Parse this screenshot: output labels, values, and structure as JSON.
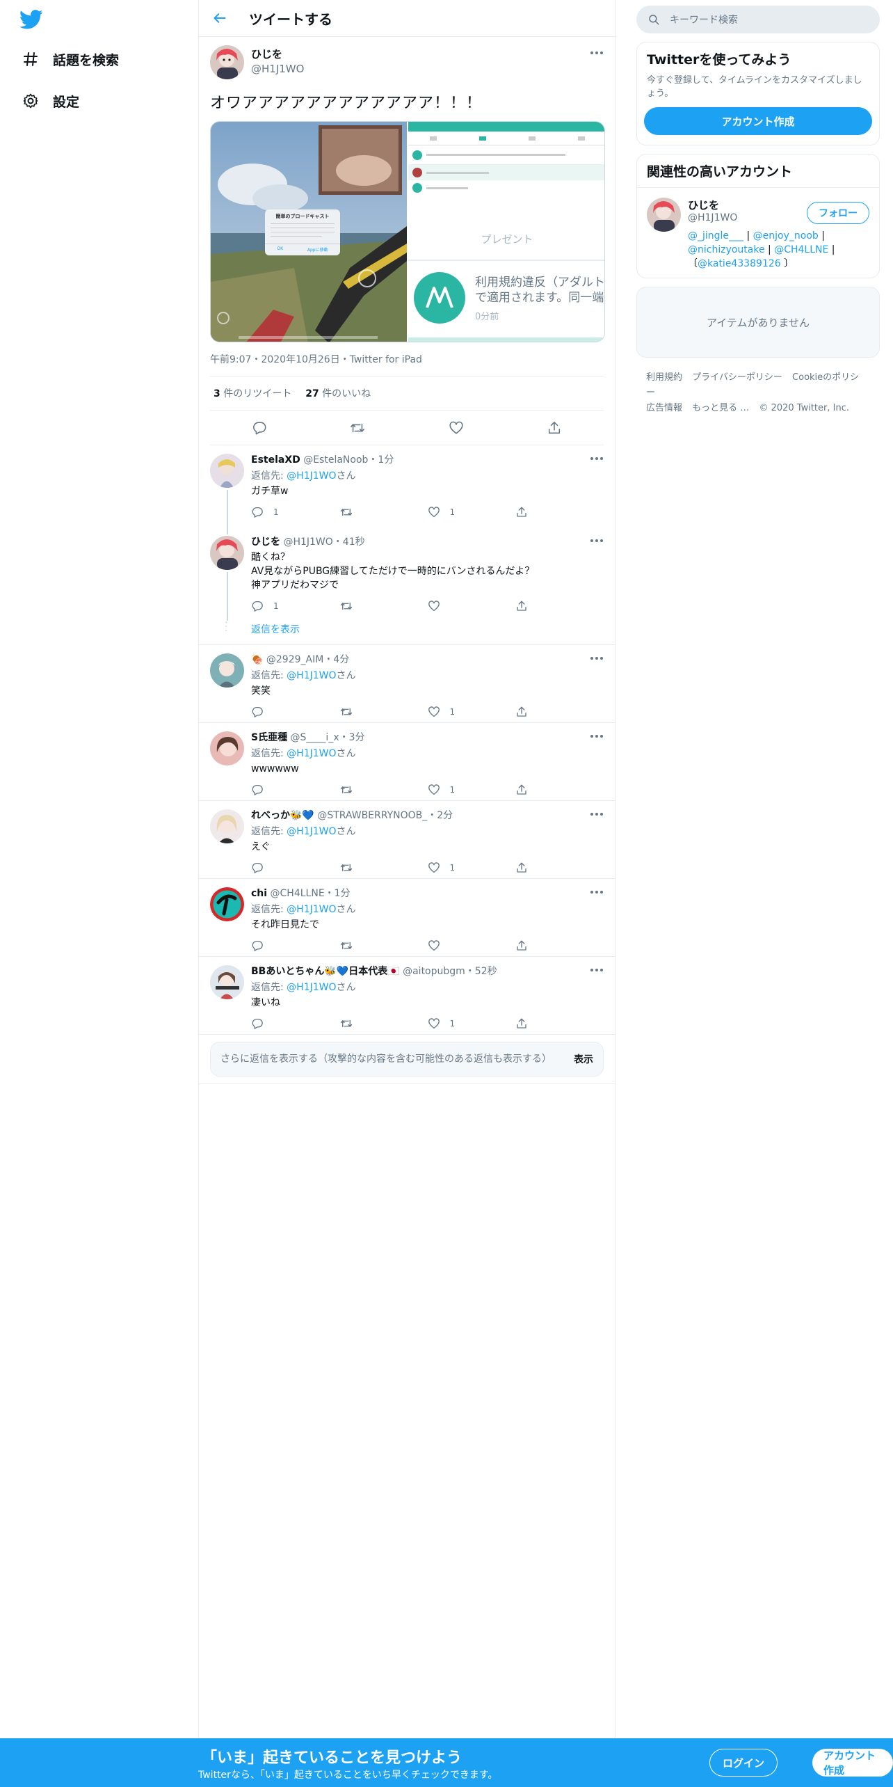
{
  "nav": {
    "items": [
      {
        "label": "話題を検索",
        "icon": "hashtag-icon"
      },
      {
        "label": "設定",
        "icon": "gear-icon"
      }
    ]
  },
  "header": {
    "title": "ツイートする"
  },
  "tweet": {
    "name": "ひじを",
    "handle": "@H1J1WO",
    "text": "オワアアアアアアアアアアアア！！！",
    "media": {
      "dialog_title": "簡単のブロードキャスト",
      "dialog_ok": "OK",
      "dialog_app": "Appに移動",
      "app_label": "プレゼント",
      "app_text1": "利用規約違反（アダルト",
      "app_text2": "で適用されます。同一端",
      "app_time": "0分前"
    },
    "meta": "午前9:07・2020年10月26日・Twitter for iPad",
    "retweets_count": "3",
    "retweets_label": "件のリツイート",
    "likes_count": "27",
    "likes_label": "件のいいね"
  },
  "replies": [
    {
      "name": "EstelaXD",
      "handle": "@EstelaNoob",
      "time": "・1分",
      "reply_label": "返信先: ",
      "reply_to": "@H1J1WO",
      "reply_suffix": "さん",
      "text": "ガチ草w",
      "reply_count": "1",
      "rt_count": "",
      "like_count": "1"
    },
    {
      "name": "ひじを",
      "handle": "@H1J1WO",
      "time": "・41秒",
      "reply_label": "",
      "reply_to": "",
      "reply_suffix": "",
      "text": "酷くね？\nAV見ながらPUBG練習してただけで一時的にバンされるんだよ？\n神アプリだわマジで",
      "reply_count": "1",
      "rt_count": "",
      "like_count": ""
    },
    {
      "name": "🍖",
      "handle": "@2929_AIM",
      "time": "・4分",
      "reply_label": "返信先: ",
      "reply_to": "@H1J1WO",
      "reply_suffix": "さん",
      "text": "笑笑",
      "reply_count": "",
      "rt_count": "",
      "like_count": "1"
    },
    {
      "name": "S氏亜種",
      "handle": "@S____i_x",
      "time": "・3分",
      "reply_label": "返信先: ",
      "reply_to": "@H1J1WO",
      "reply_suffix": "さん",
      "text": "wwwwww",
      "reply_count": "",
      "rt_count": "",
      "like_count": "1"
    },
    {
      "name": "れべっか🐝💙",
      "handle": "@STRAWBERRYNOOB_",
      "time": "・2分",
      "reply_label": "返信先: ",
      "reply_to": "@H1J1WO",
      "reply_suffix": "さん",
      "text": "えぐ",
      "reply_count": "",
      "rt_count": "",
      "like_count": "1"
    },
    {
      "name": "chi",
      "handle": "@CH4LLNE",
      "time": "・1分",
      "reply_label": "返信先: ",
      "reply_to": "@H1J1WO",
      "reply_suffix": "さん",
      "text": "それ昨日見たで",
      "reply_count": "",
      "rt_count": "",
      "like_count": ""
    },
    {
      "name": "BBあいとちゃん🐝💙日本代表🇯🇵",
      "handle": "@aitopubgm",
      "time": "・52秒",
      "reply_label": "返信先: ",
      "reply_to": "@H1J1WO",
      "reply_suffix": "さん",
      "text": "凄いね",
      "reply_count": "",
      "rt_count": "",
      "like_count": "1"
    }
  ],
  "show_replies": "返信を表示",
  "more_replies": {
    "text": "さらに返信を表示する（攻撃的な内容を含む可能性のある返信も表示する）",
    "button": "表示"
  },
  "right": {
    "search_placeholder": "キーワード検索",
    "join_title": "Twitterを使ってみよう",
    "join_sub": "今すぐ登録して、タイムラインをカスタマイズしましょう。",
    "join_button": "アカウント作成",
    "related_title": "関連性の高いアカウント",
    "related": {
      "name": "ひじを",
      "handle": "@H1J1WO",
      "follow": "フォロー",
      "bio_part1": "@_jingle___",
      "bio_sep1": " | ",
      "bio_part2": "@enjoy_noob",
      "bio_sep2": " | ",
      "bio_part3": "@nichizyoutake",
      "bio_sep3": " | ",
      "bio_part4": "@CH4LLNE",
      "bio_sep4": " |〔",
      "bio_part5": "@katie43389126",
      "bio_end": " 〕"
    },
    "empty": "アイテムがありません",
    "footer": [
      "利用規約",
      "プライバシーポリシー",
      "Cookieのポリシー",
      "広告情報",
      "もっと見る …",
      "© 2020 Twitter, Inc."
    ]
  },
  "bottom": {
    "title": "「いま」起きていることを見つけよう",
    "sub": "Twitterなら、「いま」起きていることをいち早くチェックできます。",
    "login": "ログイン",
    "signup": "アカウント作成"
  },
  "colors": {
    "accent": "#1da1f2",
    "secondary_text": "#657786",
    "border": "#e6ecf0"
  }
}
